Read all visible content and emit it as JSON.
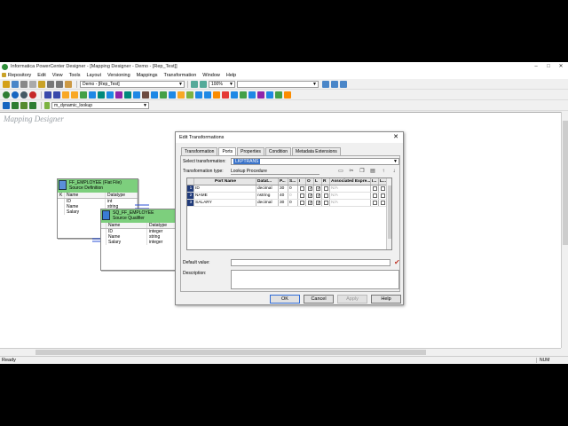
{
  "window": {
    "title": "Informatica PowerCenter Designer - [Mapping Designer - Demo - [Rep_Test]]",
    "controls": [
      "–",
      "□",
      "✕"
    ]
  },
  "menu": [
    "Repository",
    "Edit",
    "View",
    "Tools",
    "Layout",
    "Versioning",
    "Mappings",
    "Transformation",
    "Window",
    "Help"
  ],
  "toolbar": {
    "folder_combo": "Demo - [Rep_Test]",
    "zoom_combo": "100%",
    "mapping_combo": "m_dynamic_lookup"
  },
  "workspace": {
    "label": "Mapping Designer"
  },
  "source_def": {
    "header": "FF_EMPLOYEE (Flat File)",
    "subheader": "Source Definition",
    "columns": [
      "K",
      "Name",
      "Datatype"
    ],
    "rows": [
      {
        "name": "ID",
        "type": "int"
      },
      {
        "name": "Name",
        "type": "string"
      },
      {
        "name": "Salary",
        "type": ""
      }
    ]
  },
  "source_qual": {
    "header": "SQ_FF_EMPLOYEE",
    "subheader": "Source Qualifier",
    "columns": [
      "Name",
      "Datatype"
    ],
    "rows": [
      {
        "name": "ID",
        "type": "integer"
      },
      {
        "name": "Name",
        "type": "string"
      },
      {
        "name": "Salary",
        "type": "integer"
      }
    ]
  },
  "dialog": {
    "title": "Edit Transformations",
    "close": "✕",
    "tabs": [
      "Transformation",
      "Ports",
      "Properties",
      "Condition",
      "Metadata Extensions"
    ],
    "active_tab": "Ports",
    "select_label": "Select transformation:",
    "select_value": "LKPTRANS",
    "type_label": "Transformation type:",
    "type_value": "Lookup Procedure",
    "grid_headers": [
      "",
      "Port Name",
      "Datat...",
      "P...",
      "S...",
      "I",
      "O",
      "L",
      "R",
      "Associated Expre...",
      "I...",
      "L..."
    ],
    "ports": [
      {
        "num": "1",
        "name": "ID",
        "dtype": "decimal",
        "p": "30",
        "s": "0",
        "i": false,
        "o": true,
        "l": true,
        "r": false,
        "expr": "N/A"
      },
      {
        "num": "2",
        "name": "NAME",
        "dtype": "nstring",
        "p": "40",
        "s": "0",
        "i": false,
        "o": true,
        "l": true,
        "r": false,
        "expr": "N/A"
      },
      {
        "num": "3",
        "name": "SALARY",
        "dtype": "decimal",
        "p": "30",
        "s": "0",
        "i": false,
        "o": true,
        "l": true,
        "r": false,
        "expr": "N/A"
      }
    ],
    "default_label": "Default value:",
    "desc_label": "Description:",
    "buttons": {
      "ok": "OK",
      "cancel": "Cancel",
      "apply": "Apply",
      "help": "Help"
    }
  },
  "status": {
    "left": "Ready",
    "num": "NUM"
  }
}
